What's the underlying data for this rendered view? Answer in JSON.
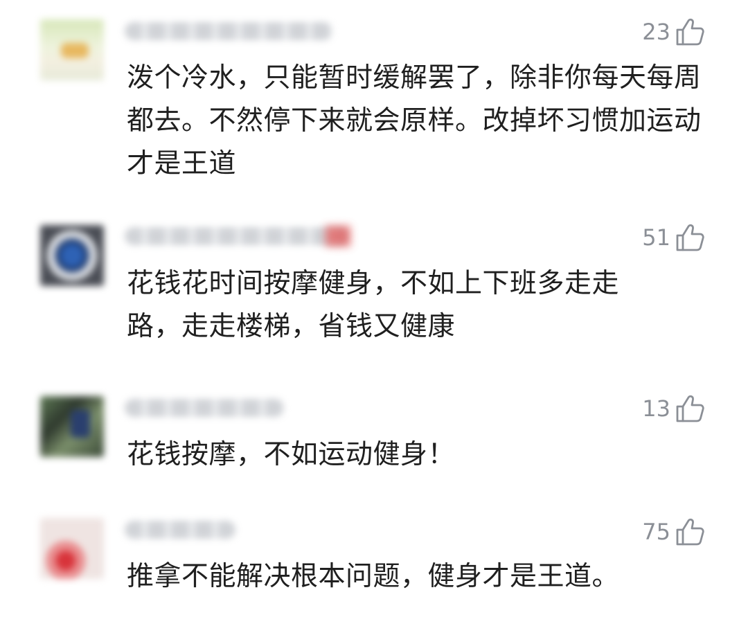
{
  "comments": [
    {
      "likes": "23",
      "text": "泼个冷水，只能暂时缓解罢了，除非你每天每周都去。不然停下来就会原样。改掉坏习惯加运动才是王道"
    },
    {
      "likes": "51",
      "text": "花钱花时间按摩健身，不如上下班多走走路，走走楼梯，省钱又健康"
    },
    {
      "likes": "13",
      "text": "花钱按摩，不如运动健身！"
    },
    {
      "likes": "75",
      "text": "推拿不能解决根本问题，健身才是王道。"
    }
  ],
  "colors": {
    "text": "#1f1f1f",
    "meta": "#8b8f96"
  },
  "icons": {
    "like": "thumbs-up-icon"
  }
}
